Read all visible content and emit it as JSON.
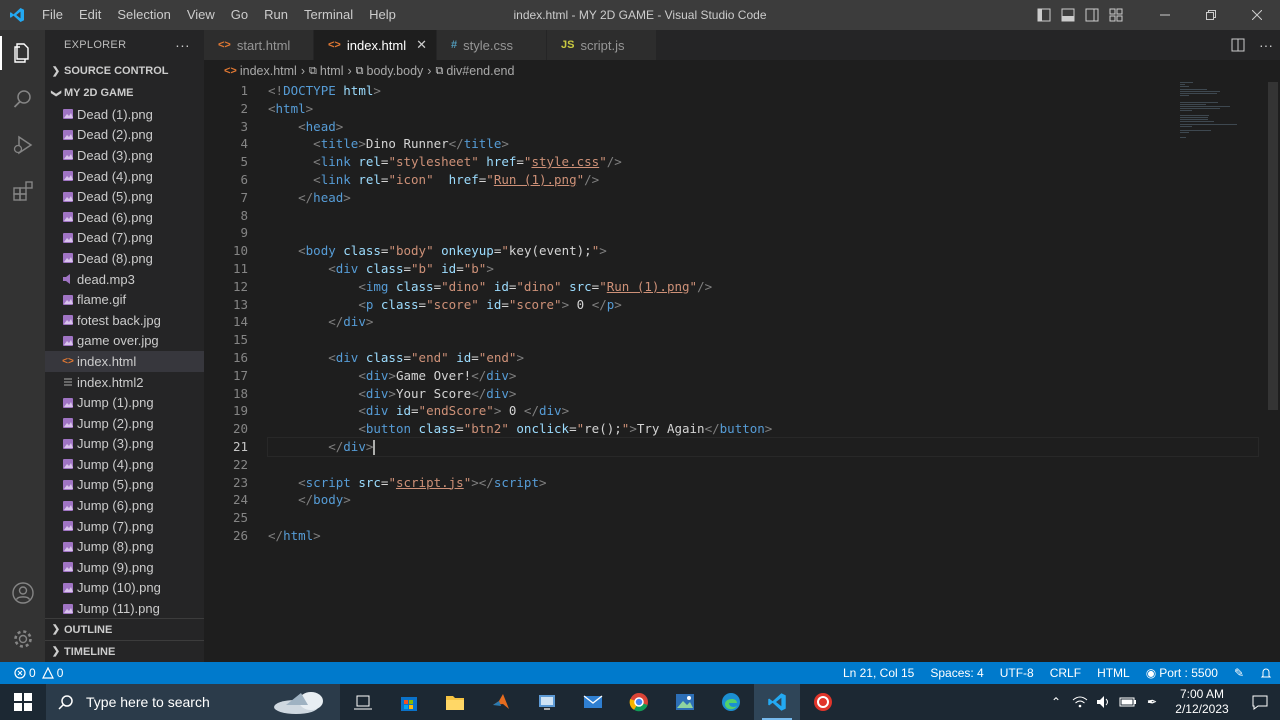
{
  "window": {
    "title": "index.html - MY 2D GAME - Visual Studio Code",
    "menu": [
      "File",
      "Edit",
      "Selection",
      "View",
      "Go",
      "Run",
      "Terminal",
      "Help"
    ]
  },
  "sidebar": {
    "header": "EXPLORER",
    "more": "···",
    "source_control": "SOURCE CONTROL",
    "folder": "MY 2D GAME",
    "files": [
      {
        "name": "Dead (1).png",
        "type": "image"
      },
      {
        "name": "Dead (2).png",
        "type": "image"
      },
      {
        "name": "Dead (3).png",
        "type": "image"
      },
      {
        "name": "Dead (4).png",
        "type": "image"
      },
      {
        "name": "Dead (5).png",
        "type": "image"
      },
      {
        "name": "Dead (6).png",
        "type": "image"
      },
      {
        "name": "Dead (7).png",
        "type": "image"
      },
      {
        "name": "Dead (8).png",
        "type": "image"
      },
      {
        "name": "dead.mp3",
        "type": "audio"
      },
      {
        "name": "flame.gif",
        "type": "image"
      },
      {
        "name": "fotest back.jpg",
        "type": "image"
      },
      {
        "name": "game over.jpg",
        "type": "image"
      },
      {
        "name": "index.html",
        "type": "html"
      },
      {
        "name": "index.html2",
        "type": "text"
      },
      {
        "name": "Jump (1).png",
        "type": "image"
      },
      {
        "name": "Jump (2).png",
        "type": "image"
      },
      {
        "name": "Jump (3).png",
        "type": "image"
      },
      {
        "name": "Jump (4).png",
        "type": "image"
      },
      {
        "name": "Jump (5).png",
        "type": "image"
      },
      {
        "name": "Jump (6).png",
        "type": "image"
      },
      {
        "name": "Jump (7).png",
        "type": "image"
      },
      {
        "name": "Jump (8).png",
        "type": "image"
      },
      {
        "name": "Jump (9).png",
        "type": "image"
      },
      {
        "name": "Jump (10).png",
        "type": "image"
      },
      {
        "name": "Jump (11).png",
        "type": "image"
      }
    ],
    "selected_file": "index.html",
    "outline": "OUTLINE",
    "timeline": "TIMELINE"
  },
  "tabs": [
    {
      "label": "start.html",
      "icon": "<>",
      "icon_color": "#e37933",
      "active": false
    },
    {
      "label": "index.html",
      "icon": "<>",
      "icon_color": "#e37933",
      "active": true
    },
    {
      "label": "style.css",
      "icon": "#",
      "icon_color": "#519aba",
      "active": false
    },
    {
      "label": "script.js",
      "icon": "JS",
      "icon_color": "#cbcb41",
      "active": false
    }
  ],
  "breadcrumb": [
    "index.html",
    "html",
    "body.body",
    "div#end.end"
  ],
  "editor": {
    "current_line": 21,
    "lines": [
      [
        [
          "p",
          "<!"
        ],
        [
          "t",
          "DOCTYPE"
        ],
        [
          "x",
          " "
        ],
        [
          "a",
          "html"
        ],
        [
          "p",
          ">"
        ]
      ],
      [
        [
          "p",
          "<"
        ],
        [
          "t",
          "html"
        ],
        [
          "p",
          ">"
        ]
      ],
      [
        [
          "x",
          "    "
        ],
        [
          "p",
          "<"
        ],
        [
          "t",
          "head"
        ],
        [
          "p",
          ">"
        ]
      ],
      [
        [
          "x",
          "      "
        ],
        [
          "p",
          "<"
        ],
        [
          "t",
          "title"
        ],
        [
          "p",
          ">"
        ],
        [
          "x",
          "Dino Runner"
        ],
        [
          "p",
          "</"
        ],
        [
          "t",
          "title"
        ],
        [
          "p",
          ">"
        ]
      ],
      [
        [
          "x",
          "      "
        ],
        [
          "p",
          "<"
        ],
        [
          "t",
          "link"
        ],
        [
          "x",
          " "
        ],
        [
          "a",
          "rel"
        ],
        [
          "x",
          "="
        ],
        [
          "s",
          "\"stylesheet\""
        ],
        [
          "x",
          " "
        ],
        [
          "a",
          "href"
        ],
        [
          "x",
          "="
        ],
        [
          "s",
          "\""
        ],
        [
          "u",
          "style.css"
        ],
        [
          "s",
          "\""
        ],
        [
          "p",
          "/>"
        ]
      ],
      [
        [
          "x",
          "      "
        ],
        [
          "p",
          "<"
        ],
        [
          "t",
          "link"
        ],
        [
          "x",
          " "
        ],
        [
          "a",
          "rel"
        ],
        [
          "x",
          "="
        ],
        [
          "s",
          "\"icon\""
        ],
        [
          "x",
          "  "
        ],
        [
          "a",
          "href"
        ],
        [
          "x",
          "="
        ],
        [
          "s",
          "\""
        ],
        [
          "u",
          "Run (1).png"
        ],
        [
          "s",
          "\""
        ],
        [
          "p",
          "/>"
        ]
      ],
      [
        [
          "x",
          "    "
        ],
        [
          "p",
          "</"
        ],
        [
          "t",
          "head"
        ],
        [
          "p",
          ">"
        ]
      ],
      [],
      [],
      [
        [
          "x",
          "    "
        ],
        [
          "p",
          "<"
        ],
        [
          "t",
          "body"
        ],
        [
          "x",
          " "
        ],
        [
          "a",
          "class"
        ],
        [
          "x",
          "="
        ],
        [
          "s",
          "\"body\""
        ],
        [
          "x",
          " "
        ],
        [
          "a",
          "onkeyup"
        ],
        [
          "x",
          "="
        ],
        [
          "s",
          "\""
        ],
        [
          "x",
          "key(event);"
        ],
        [
          "s",
          "\""
        ],
        [
          "p",
          ">"
        ]
      ],
      [
        [
          "x",
          "        "
        ],
        [
          "p",
          "<"
        ],
        [
          "t",
          "div"
        ],
        [
          "x",
          " "
        ],
        [
          "a",
          "class"
        ],
        [
          "x",
          "="
        ],
        [
          "s",
          "\"b\""
        ],
        [
          "x",
          " "
        ],
        [
          "a",
          "id"
        ],
        [
          "x",
          "="
        ],
        [
          "s",
          "\"b\""
        ],
        [
          "p",
          ">"
        ]
      ],
      [
        [
          "x",
          "            "
        ],
        [
          "p",
          "<"
        ],
        [
          "t",
          "img"
        ],
        [
          "x",
          " "
        ],
        [
          "a",
          "class"
        ],
        [
          "x",
          "="
        ],
        [
          "s",
          "\"dino\""
        ],
        [
          "x",
          " "
        ],
        [
          "a",
          "id"
        ],
        [
          "x",
          "="
        ],
        [
          "s",
          "\"dino\""
        ],
        [
          "x",
          " "
        ],
        [
          "a",
          "src"
        ],
        [
          "x",
          "="
        ],
        [
          "s",
          "\""
        ],
        [
          "u",
          "Run (1).png"
        ],
        [
          "s",
          "\""
        ],
        [
          "p",
          "/>"
        ]
      ],
      [
        [
          "x",
          "            "
        ],
        [
          "p",
          "<"
        ],
        [
          "t",
          "p"
        ],
        [
          "x",
          " "
        ],
        [
          "a",
          "class"
        ],
        [
          "x",
          "="
        ],
        [
          "s",
          "\"score\""
        ],
        [
          "x",
          " "
        ],
        [
          "a",
          "id"
        ],
        [
          "x",
          "="
        ],
        [
          "s",
          "\"score\""
        ],
        [
          "p",
          ">"
        ],
        [
          "x",
          " 0 "
        ],
        [
          "p",
          "</"
        ],
        [
          "t",
          "p"
        ],
        [
          "p",
          ">"
        ]
      ],
      [
        [
          "x",
          "        "
        ],
        [
          "p",
          "</"
        ],
        [
          "t",
          "div"
        ],
        [
          "p",
          ">"
        ]
      ],
      [],
      [
        [
          "x",
          "        "
        ],
        [
          "p",
          "<"
        ],
        [
          "t",
          "div"
        ],
        [
          "x",
          " "
        ],
        [
          "a",
          "class"
        ],
        [
          "x",
          "="
        ],
        [
          "s",
          "\"end\""
        ],
        [
          "x",
          " "
        ],
        [
          "a",
          "id"
        ],
        [
          "x",
          "="
        ],
        [
          "s",
          "\"end\""
        ],
        [
          "p",
          ">"
        ]
      ],
      [
        [
          "x",
          "            "
        ],
        [
          "p",
          "<"
        ],
        [
          "t",
          "div"
        ],
        [
          "p",
          ">"
        ],
        [
          "x",
          "Game Over!"
        ],
        [
          "p",
          "</"
        ],
        [
          "t",
          "div"
        ],
        [
          "p",
          ">"
        ]
      ],
      [
        [
          "x",
          "            "
        ],
        [
          "p",
          "<"
        ],
        [
          "t",
          "div"
        ],
        [
          "p",
          ">"
        ],
        [
          "x",
          "Your Score"
        ],
        [
          "p",
          "</"
        ],
        [
          "t",
          "div"
        ],
        [
          "p",
          ">"
        ]
      ],
      [
        [
          "x",
          "            "
        ],
        [
          "p",
          "<"
        ],
        [
          "t",
          "div"
        ],
        [
          "x",
          " "
        ],
        [
          "a",
          "id"
        ],
        [
          "x",
          "="
        ],
        [
          "s",
          "\"endScore\""
        ],
        [
          "p",
          ">"
        ],
        [
          "x",
          " 0 "
        ],
        [
          "p",
          "</"
        ],
        [
          "t",
          "div"
        ],
        [
          "p",
          ">"
        ]
      ],
      [
        [
          "x",
          "            "
        ],
        [
          "p",
          "<"
        ],
        [
          "t",
          "button"
        ],
        [
          "x",
          " "
        ],
        [
          "a",
          "class"
        ],
        [
          "x",
          "="
        ],
        [
          "s",
          "\"btn2\""
        ],
        [
          "x",
          " "
        ],
        [
          "a",
          "onclick"
        ],
        [
          "x",
          "="
        ],
        [
          "s",
          "\""
        ],
        [
          "x",
          "re();"
        ],
        [
          "s",
          "\""
        ],
        [
          "p",
          ">"
        ],
        [
          "x",
          "Try Again"
        ],
        [
          "p",
          "</"
        ],
        [
          "t",
          "button"
        ],
        [
          "p",
          ">"
        ]
      ],
      [
        [
          "x",
          "        "
        ],
        [
          "p",
          "</"
        ],
        [
          "t",
          "div"
        ],
        [
          "p",
          ">"
        ]
      ],
      [],
      [
        [
          "x",
          "    "
        ],
        [
          "p",
          "<"
        ],
        [
          "t",
          "script"
        ],
        [
          "x",
          " "
        ],
        [
          "a",
          "src"
        ],
        [
          "x",
          "="
        ],
        [
          "s",
          "\""
        ],
        [
          "u",
          "script.js"
        ],
        [
          "s",
          "\""
        ],
        [
          "p",
          "></"
        ],
        [
          "t",
          "script"
        ],
        [
          "p",
          ">"
        ]
      ],
      [
        [
          "x",
          "    "
        ],
        [
          "p",
          "</"
        ],
        [
          "t",
          "body"
        ],
        [
          "p",
          ">"
        ]
      ],
      [],
      [
        [
          "p",
          "</"
        ],
        [
          "t",
          "html"
        ],
        [
          "p",
          ">"
        ]
      ]
    ]
  },
  "statusbar": {
    "errors": "0",
    "warnings": "0",
    "position": "Ln 21, Col 15",
    "spaces": "Spaces: 4",
    "encoding": "UTF-8",
    "eol": "CRLF",
    "language": "HTML",
    "port": "Port : 5500"
  },
  "taskbar": {
    "search_placeholder": "Type here to search",
    "time": "7:00 AM",
    "date": "2/12/2023"
  },
  "colors": {
    "accent": "#007acc",
    "html_icon": "#e37933",
    "image_icon": "#a074c4",
    "audio_icon": "#a074c4"
  }
}
